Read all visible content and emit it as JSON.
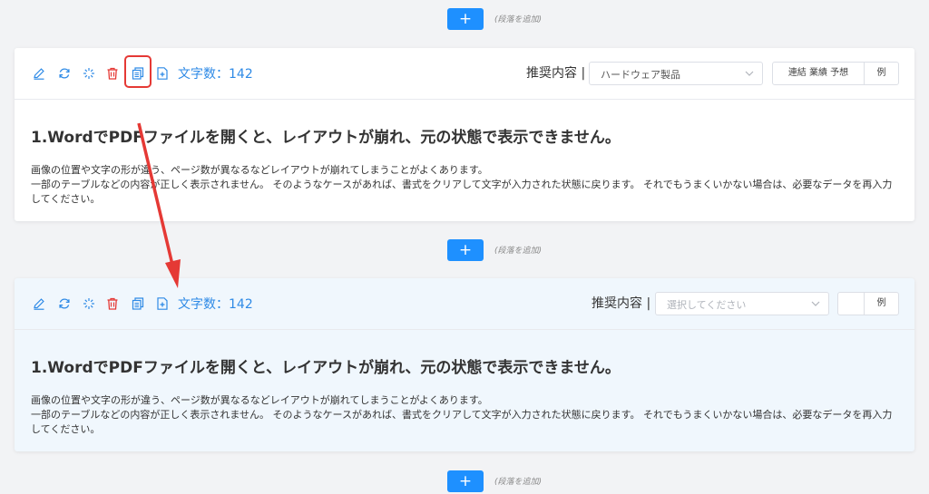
{
  "add_hint": "(段落を追加)",
  "add_symbol": "+",
  "card1": {
    "word_count_label": "文字数：",
    "word_count": "142",
    "recommend_label": "推奨内容 |",
    "select_value": "ハードウェア製品",
    "keywords": "連結 業績 予想",
    "example_label": "例",
    "heading": "1.WordでPDFファイルを開くと、レイアウトが崩れ、元の状態で表示できません。",
    "paragraph": "画像の位置や文字の形が違う、ページ数が異なるなどレイアウトが崩れてしまうことがよくあります。\n一部のテーブルなどの内容が正しく表示されません。 そのようなケースがあれば、書式をクリアして文字が入力された状態に戻ります。 それでもうまくいかない場合は、必要なデータを再入力してください。"
  },
  "card2": {
    "word_count_label": "文字数：",
    "word_count": "142",
    "recommend_label": "推奨内容 |",
    "select_placeholder": "選択してください",
    "keywords": "",
    "example_label": "例",
    "heading": "1.WordでPDFファイルを開くと、レイアウトが崩れ、元の状態で表示できません。",
    "paragraph": "画像の位置や文字の形が違う、ページ数が異なるなどレイアウトが崩れてしまうことがよくあります。\n一部のテーブルなどの内容が正しく表示されません。 そのようなケースがあれば、書式をクリアして文字が入力された状態に戻ります。 それでもうまくいかない場合は、必要なデータを再入力してください。"
  },
  "icons": [
    "edit-icon",
    "refresh-icon",
    "sparkle-icon",
    "delete-icon",
    "copy-icon",
    "insert-icon"
  ],
  "colors": {
    "accent": "#1e90ff",
    "icon_blue": "#2e8ae6",
    "delete_red": "#e53935",
    "active_card_bg": "#f0f7fd",
    "annotation_red": "#e53935"
  }
}
